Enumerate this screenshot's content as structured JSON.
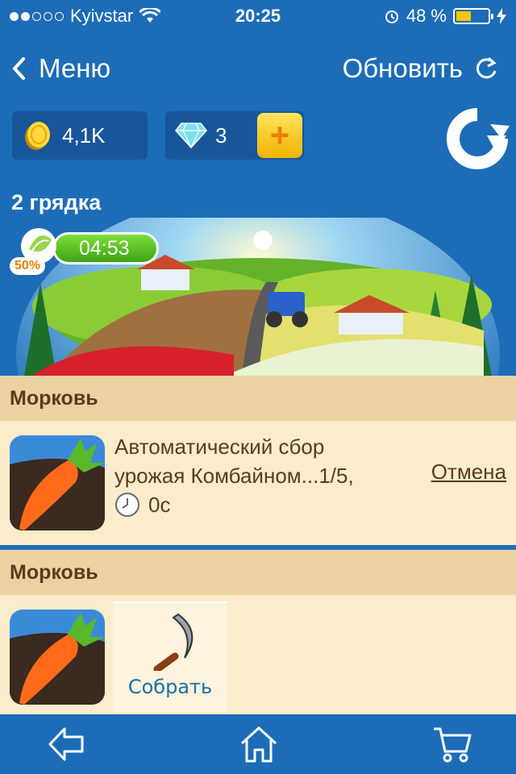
{
  "status_bar": {
    "carrier": "Kyivstar",
    "time": "20:25",
    "battery_text": "48 %",
    "battery_level": 0.48,
    "signal_dots_filled": 2,
    "signal_dots_total": 5
  },
  "nav": {
    "back_label": "Меню",
    "refresh_label": "Обновить"
  },
  "resources": {
    "coins": "4,1K",
    "gems": "3",
    "plus": "+"
  },
  "bed": {
    "title": "2 грядка",
    "timer": "04:53",
    "progress_label": "50%"
  },
  "jobs": [
    {
      "crop": "Морковь",
      "text_line1": "Автоматический сбор",
      "text_line2": "урожая Комбайном...1/5,",
      "time_left": "0с",
      "cancel_label": "Отмена"
    },
    {
      "crop": "Морковь",
      "collect_label": "Собрать"
    }
  ],
  "colors": {
    "background": "#1c6cb8",
    "card_header": "#ead2a2",
    "card_body": "#fbeccc",
    "timer_green": "#3aa514",
    "accent_orange": "#f07e00"
  },
  "icons": [
    "wifi-icon",
    "alarm-icon",
    "charging-icon",
    "back-chevron-icon",
    "refresh-icon",
    "coin-icon",
    "gem-icon",
    "plus-icon",
    "big-refresh-icon",
    "clock-icon",
    "sickle-icon",
    "back-arrow-icon",
    "home-icon",
    "cart-icon"
  ]
}
